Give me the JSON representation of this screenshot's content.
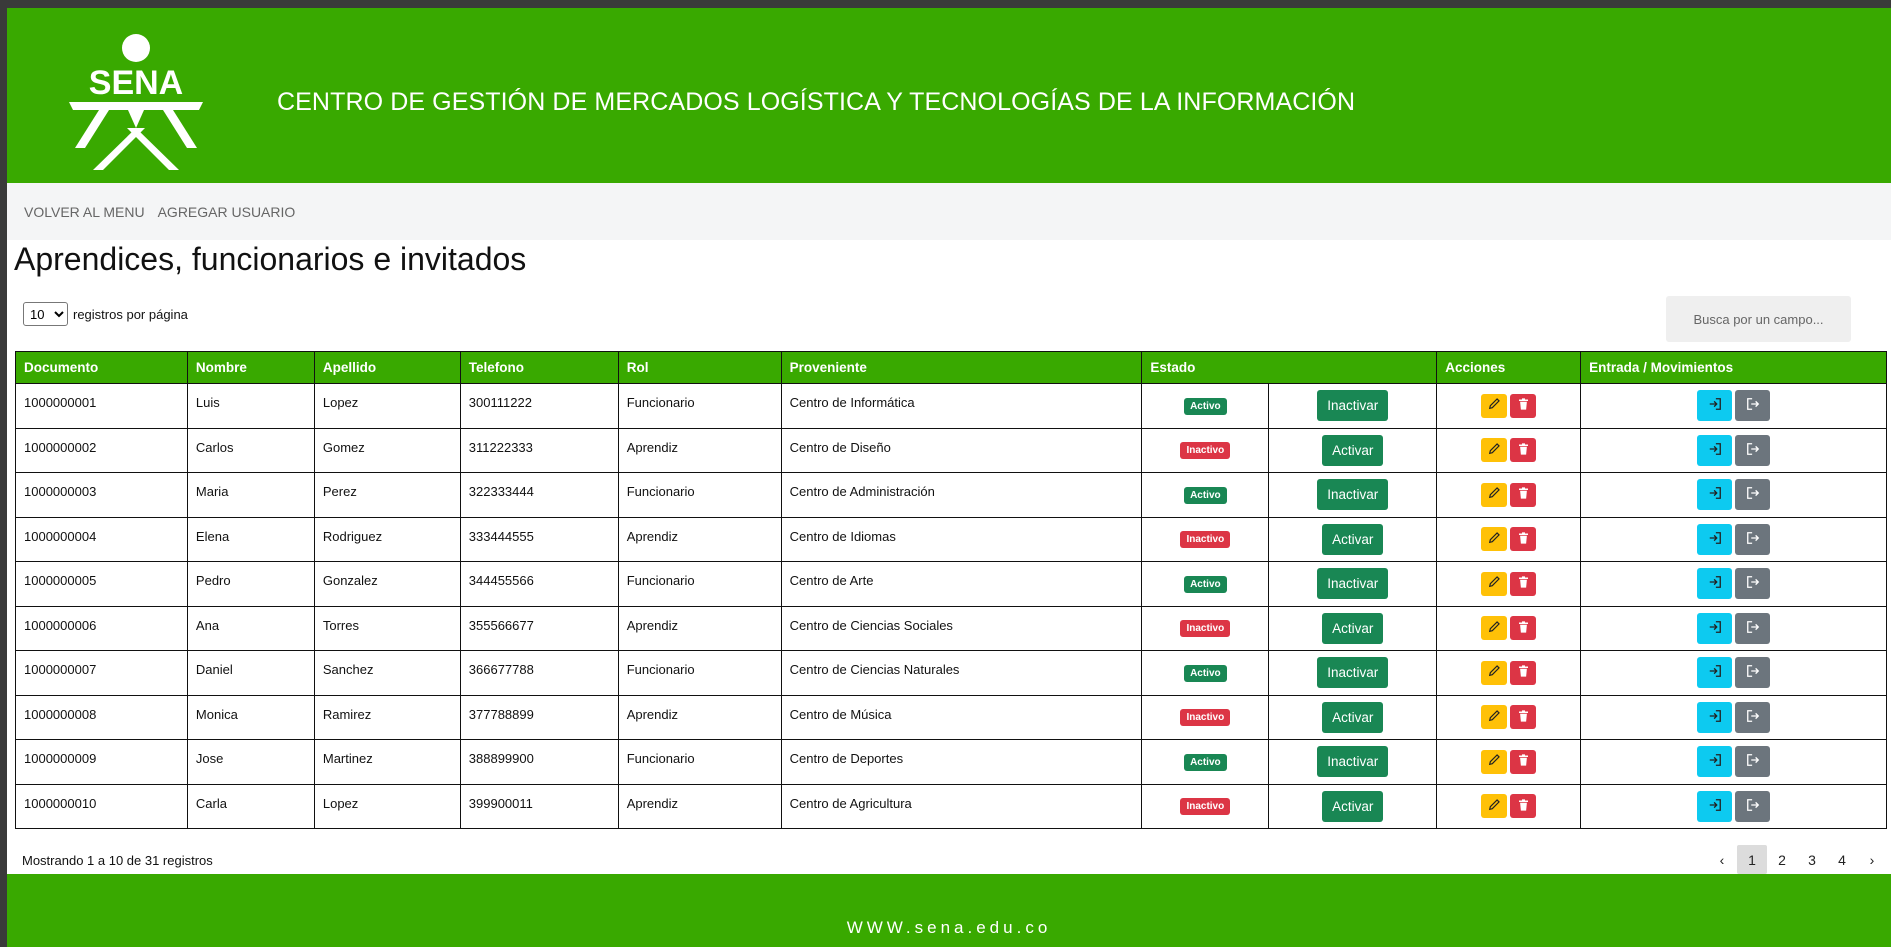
{
  "header": {
    "logo_text": "SENA",
    "center_title": "CENTRO DE GESTIÓN DE MERCADOS LOGÍSTICA Y TECNOLOGÍAS DE LA INFORMACIÓN"
  },
  "nav": {
    "back_label": "VOLVER AL MENU",
    "add_user_label": "AGREGAR USUARIO"
  },
  "main": {
    "title": "Aprendices, funcionarios e invitados",
    "per_page_value": "10",
    "per_page_label": "registros por página",
    "search_placeholder": "Busca por un campo..."
  },
  "table": {
    "headers": [
      "Documento",
      "Nombre",
      "Apellido",
      "Telefono",
      "Rol",
      "Proveniente",
      "Estado",
      "Acciones",
      "Entrada / Movimientos"
    ],
    "rows": [
      {
        "documento": "1000000001",
        "nombre": "Luis",
        "apellido": "Lopez",
        "telefono": "300111222",
        "rol": "Funcionario",
        "proveniente": "Centro de Informática",
        "estado": "Activo",
        "accion_estado": "Inactivar"
      },
      {
        "documento": "1000000002",
        "nombre": "Carlos",
        "apellido": "Gomez",
        "telefono": "311222333",
        "rol": "Aprendiz",
        "proveniente": "Centro de Diseño",
        "estado": "Inactivo",
        "accion_estado": "Activar"
      },
      {
        "documento": "1000000003",
        "nombre": "Maria",
        "apellido": "Perez",
        "telefono": "322333444",
        "rol": "Funcionario",
        "proveniente": "Centro de Administración",
        "estado": "Activo",
        "accion_estado": "Inactivar"
      },
      {
        "documento": "1000000004",
        "nombre": "Elena",
        "apellido": "Rodriguez",
        "telefono": "333444555",
        "rol": "Aprendiz",
        "proveniente": "Centro de Idiomas",
        "estado": "Inactivo",
        "accion_estado": "Activar"
      },
      {
        "documento": "1000000005",
        "nombre": "Pedro",
        "apellido": "Gonzalez",
        "telefono": "344455566",
        "rol": "Funcionario",
        "proveniente": "Centro de Arte",
        "estado": "Activo",
        "accion_estado": "Inactivar"
      },
      {
        "documento": "1000000006",
        "nombre": "Ana",
        "apellido": "Torres",
        "telefono": "355566677",
        "rol": "Aprendiz",
        "proveniente": "Centro de Ciencias Sociales",
        "estado": "Inactivo",
        "accion_estado": "Activar"
      },
      {
        "documento": "1000000007",
        "nombre": "Daniel",
        "apellido": "Sanchez",
        "telefono": "366677788",
        "rol": "Funcionario",
        "proveniente": "Centro de Ciencias Naturales",
        "estado": "Activo",
        "accion_estado": "Inactivar"
      },
      {
        "documento": "1000000008",
        "nombre": "Monica",
        "apellido": "Ramirez",
        "telefono": "377788899",
        "rol": "Aprendiz",
        "proveniente": "Centro de Música",
        "estado": "Inactivo",
        "accion_estado": "Activar"
      },
      {
        "documento": "1000000009",
        "nombre": "Jose",
        "apellido": "Martinez",
        "telefono": "388899900",
        "rol": "Funcionario",
        "proveniente": "Centro de Deportes",
        "estado": "Activo",
        "accion_estado": "Inactivar"
      },
      {
        "documento": "1000000010",
        "nombre": "Carla",
        "apellido": "Lopez",
        "telefono": "399900011",
        "rol": "Aprendiz",
        "proveniente": "Centro de Agricultura",
        "estado": "Inactivo",
        "accion_estado": "Activar"
      }
    ]
  },
  "pagination": {
    "info": "Mostrando 1 a 10 de 31 registros",
    "prev": "‹",
    "pages": [
      "1",
      "2",
      "3",
      "4"
    ],
    "current": "1",
    "next": "›"
  },
  "footer": {
    "url": "WWW.sena.edu.co"
  },
  "colors": {
    "brand_green": "#39a900",
    "active_badge": "#198754",
    "inactive_badge": "#dc3545",
    "edit_button": "#ffc107",
    "delete_button": "#dc3545",
    "entry_button": "#0dcaf0",
    "exit_button": "#6c757d"
  },
  "icons": {
    "edit": "pencil-icon",
    "delete": "trash-icon",
    "entry": "sign-in-icon",
    "exit": "sign-out-icon"
  }
}
